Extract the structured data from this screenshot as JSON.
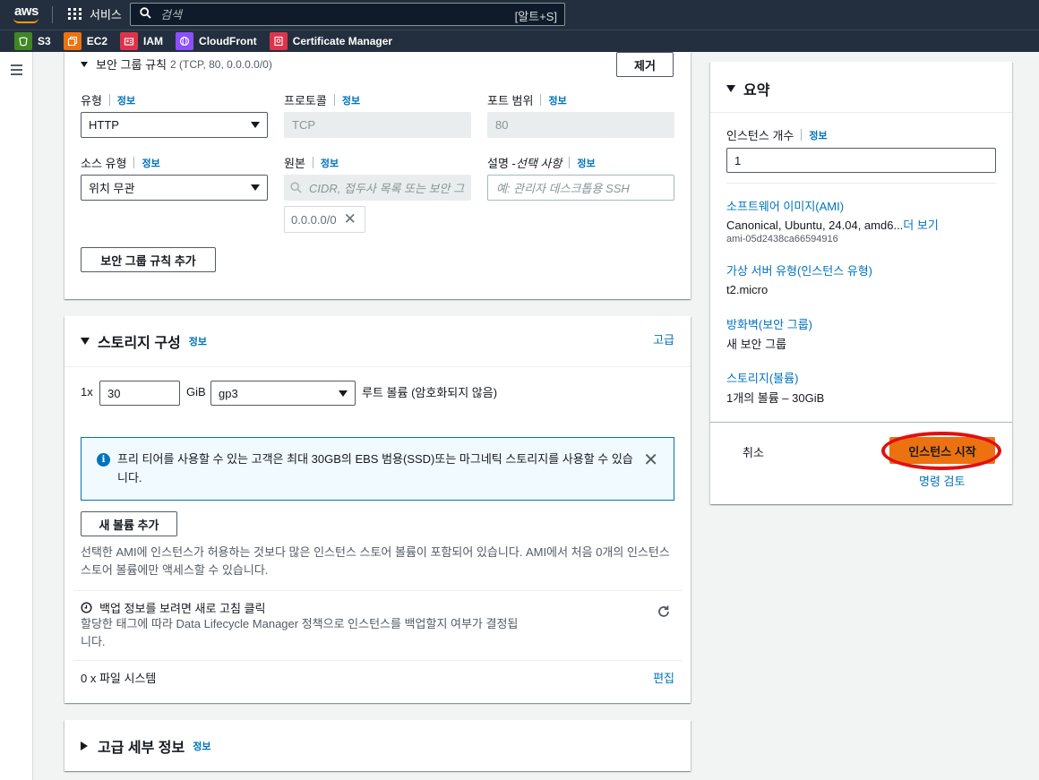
{
  "nav": {
    "logo": "aws",
    "services_label": "서비스",
    "search_placeholder": "검색",
    "search_shortcut": "[알트+S]",
    "favorites": [
      {
        "label": "S3",
        "color": "#3f8624"
      },
      {
        "label": "EC2",
        "color": "#ec7211"
      },
      {
        "label": "IAM",
        "color": "#dd344c"
      },
      {
        "label": "CloudFront",
        "color": "#8c4fff"
      },
      {
        "label": "Certificate Manager",
        "color": "#dd344c"
      }
    ]
  },
  "sg_rule": {
    "title": "보안 그룹 규칙",
    "subtitle": "2 (TCP, 80, 0.0.0.0/0)",
    "remove_button": "제거",
    "type_label": "유형",
    "type_value": "HTTP",
    "protocol_label": "프로토콜",
    "protocol_value": "TCP",
    "port_label": "포트 범위",
    "port_value": "80",
    "source_type_label": "소스 유형",
    "source_type_value": "위치 무관",
    "source_label": "원본",
    "source_placeholder": "CIDR, 접두사 목록 또는 보안 그",
    "source_token": "0.0.0.0/0",
    "desc_label": "설명 - ",
    "desc_label_optional": "선택 사항",
    "desc_placeholder": "예: 관리자 데스크톱용 SSH",
    "add_rule_button": "보안 그룹 규칙 추가",
    "info": "정보"
  },
  "storage": {
    "title": "스토리지 구성",
    "info": "정보",
    "advanced_link": "고급",
    "count_prefix": "1x",
    "size_value": "30",
    "size_unit": "GiB",
    "volume_type": "gp3",
    "volume_desc": "루트 볼륨  (암호화되지 않음)",
    "alert_text": "프리 티어를 사용할 수 있는 고객은 최대 30GB의 EBS 범용(SSD)또는 마그네틱 스토리지를 사용할 수 있습니다.",
    "add_volume_button": "새 볼륨 추가",
    "ami_note": "선택한 AMI에 인스턴스가 허용하는 것보다 많은 인스턴스 스토어 볼륨이 포함되어 있습니다. AMI에서 처음 0개의 인스턴스 스토어 볼륨에만 액세스할 수 있습니다.",
    "backup_title": "백업 정보를 보려면 새로 고침 클릭",
    "backup_desc": "할당한 태그에 따라 Data Lifecycle Manager 정책으로 인스턴스를 백업할지 여부가 결정됩니다.",
    "fs_label": "0 x 파일 시스템",
    "edit_link": "편집"
  },
  "advanced": {
    "title": "고급 세부 정보",
    "info": "정보"
  },
  "summary": {
    "title": "요약",
    "instance_count_label": "인스턴스 개수",
    "info": "정보",
    "instance_count_value": "1",
    "ami_label": "소프트웨어 이미지(AMI)",
    "ami_value": "Canonical, Ubuntu, 24.04, amd6...",
    "ami_more": "더 보기",
    "ami_id": "ami-05d2438ca66594916",
    "instance_type_label": "가상 서버 유형(인스턴스 유형)",
    "instance_type_value": "t2.micro",
    "firewall_label": "방화벽(보안 그룹)",
    "firewall_value": "새 보안 그룹",
    "storage_label": "스토리지(볼륨)",
    "storage_value": "1개의 볼륨 – 30GiB",
    "cancel": "취소",
    "launch": "인스턴스 시작",
    "review": "명령 검토"
  }
}
